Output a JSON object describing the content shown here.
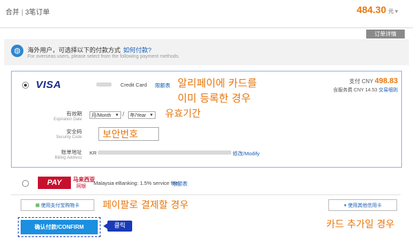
{
  "order": {
    "summary_label": "合并",
    "summary_sep": "|",
    "summary_count": "3笔订单",
    "total": "484.30",
    "currency_unit": "元",
    "detail_tab": "订单详情"
  },
  "notice": {
    "cn_text": "海外用户，可选择以下的付款方式",
    "help_link": "如何付款?",
    "en_text": "For overseas users, please select from the following payment methods."
  },
  "card": {
    "brand": "VISA",
    "type_label": "Credit Card",
    "limit_link": "限额表",
    "pay_label": "支付 CNY",
    "pay_amount": "498.83",
    "fee_text": "含服务费 CNY 14.53",
    "fee_link": "交易细则",
    "expiry_label": "有效期",
    "expiry_sub": "Expiration Date",
    "month_value": "月/Month",
    "year_value": "年/Year",
    "slash": "/",
    "cvv_label": "安全码",
    "cvv_sub": "Security Code",
    "address_label": "账单地址",
    "address_sub": "Billing Address",
    "address_prefix": "KR",
    "address_link": "修改/Modify"
  },
  "alt_method": {
    "logo": "PAY",
    "name_cn": "马来西亚",
    "name_cn2": "网银",
    "desc": "Malaysia eBanking: 1.5% service fee",
    "limit_link": "限额表"
  },
  "buttons": {
    "alt_card": "使用支付宝购物卡",
    "add_card": "使用其他信用卡",
    "confirm": "确认付款/CONFIRM",
    "click_tag": "클릭"
  },
  "annotations": {
    "registered_line1": "알리페이에 카드를",
    "registered_line2": "이미 등록한 경우",
    "expiry": "유효기간",
    "cvv": "보안번호",
    "paypal": "페이팔로 결제할 경우",
    "add_card": "카드 추가일 경우"
  }
}
